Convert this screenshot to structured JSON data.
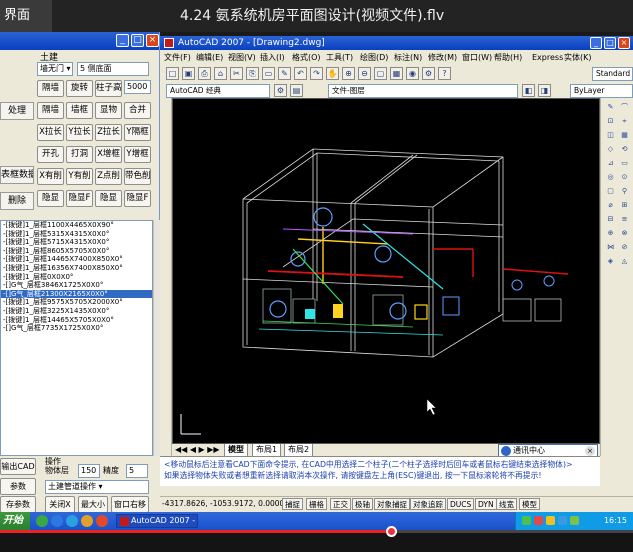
{
  "player": {
    "left_label": "界面",
    "title": "4.24 氨系统机房平面图设计(视频文件).flv",
    "progress": 0.62
  },
  "left_panel": {
    "side_labels": [
      "处理",
      "表框数据",
      "删除"
    ],
    "section_label": "土建",
    "select_a": "墙无门 ▾",
    "select_b": "5 侧底面",
    "grid_rows": [
      [
        "隔墙",
        "旋转",
        "柱子高",
        "5000"
      ],
      [
        "隔墙",
        "墙框",
        "显物",
        "合并"
      ],
      [
        "X拉长",
        "Y拉长",
        "Z拉长",
        "Y隔框"
      ],
      [
        "开孔",
        "打洞",
        "X增框",
        "Y增框"
      ],
      [
        "X有削",
        "Y有削",
        "Z点削",
        "带色削"
      ],
      [
        "隐显",
        "隐显F",
        "隐显",
        "隐显F"
      ]
    ],
    "list_rows": [
      "-[拨键]1_层框1100X4465X0X90°",
      "-[拨键]1_层框5315X4315X0X0°",
      "-[拨键]1_层框5715X4315X0X0°",
      "-[拨键]1_层框8605X5705X0X0°",
      "-[拨键]1_层框14465X7400X850X0°",
      "-[拨键]1_层框16356X7400X850X0°",
      "-[拨键]1_层框0X0X0°",
      "-[]G气_层框3846X1725X0X0°",
      "-[]G气_层框21300X2165X0X0°",
      "-[拨键]1_层框9575X5705X2000X0°",
      "-[拨键]1_层框3225X1435X0X0°",
      "-[拨键]1_层框14465X5705X0X0°",
      "-[]G气_层框7735X1725X0X0°"
    ],
    "selected_row": 8,
    "bottom": {
      "label_a": "操作",
      "field_label_1": "物体层",
      "field_val_1": "150",
      "field_label_2": "精度",
      "field_val_2": "5",
      "dropdown": "土建管道操作 ▾",
      "btn_left_1": "输出CAD",
      "btn_left_2": "参数",
      "btn_left_3": "存参数",
      "btn_close": "关闭X",
      "btn_max": "最大小",
      "btn_restore": "窗口右移"
    }
  },
  "cad": {
    "title": "AutoCAD 2007 - [Drawing2.dwg]",
    "menu": [
      "文件(F)",
      "编辑(E)",
      "视图(V)",
      "插入(I)",
      "格式(O)",
      "工具(T)",
      "绘图(D)",
      "标注(N)",
      "修改(M)",
      "窗口(W)",
      "帮助(H)",
      "Express",
      "实体(K)"
    ],
    "workspace": "AutoCAD 经典",
    "layer_combo": "文件-图层",
    "byLayer": "ByLayer",
    "standard": "Standard",
    "tabs": [
      "模型",
      "布局1",
      "布局2"
    ],
    "command_lines": [
      "<移动鼠标后注意看CAD下面命令提示, 在CAD中用选择二个柱子(二个柱子选择时后回车或者鼠标右键结束选择物体)>",
      "如果选择物体失败或者想重新选择请取消本次操作, 请按键盘左上角(ESC)键退出, 按一下鼠标滚轮将不再提示!"
    ],
    "coords": "-4317.8626, -1053.9172, 0.0000",
    "status_buttons": [
      "捕捉",
      "栅格",
      "正交",
      "极轴",
      "对象捕捉",
      "对象追踪",
      "DUCS",
      "DYN",
      "线宽",
      "模型"
    ],
    "comm_center": "通讯中心"
  },
  "taskbar": {
    "start": "开始",
    "task": "AutoCAD 2007 - [D...",
    "clock": "16:15"
  },
  "colors": {
    "xp_blue": "#0a3fbe",
    "cad_bg": "#000000",
    "selected_row": "#316ac5",
    "progress_red": "#e22222"
  }
}
